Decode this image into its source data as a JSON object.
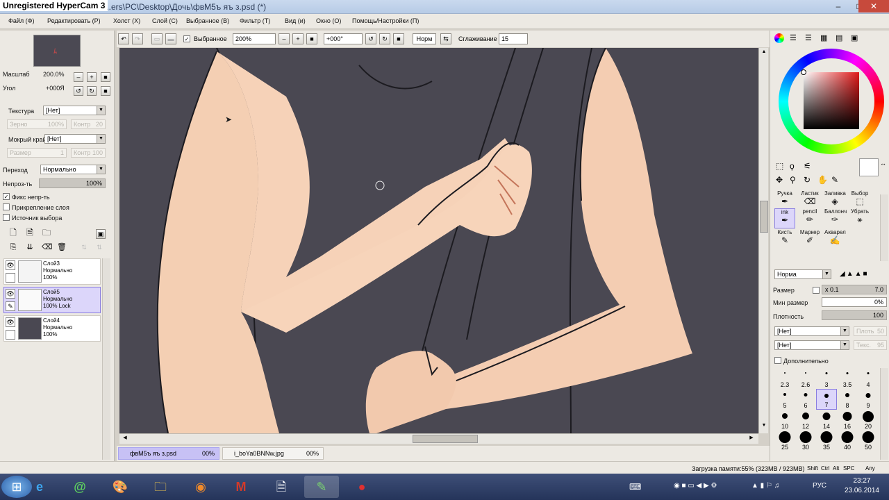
{
  "hypercam_label": "Unregistered HyperCam 3",
  "window": {
    "title": "...ers\\PC\\Desktop\\Дочь\\фвМ5ъ яъ з.psd (*)",
    "controls": [
      "–",
      "□",
      "✕"
    ]
  },
  "menu": [
    "Файл (Ф)",
    "Редактировать (Р)",
    "Холст (Х)",
    "Слой (С)",
    "Выбранное (В)",
    "Фильтр (Т)",
    "Вид (и)",
    "Окно (О)",
    "Помощь/Настройки (П)"
  ],
  "toolbar": {
    "selection_label": "Выбранное",
    "zoom_value": "200%",
    "angle_value": "+000°",
    "mode_label": "Норм",
    "smoothing_label": "Сглаживание",
    "smoothing_value": "15"
  },
  "left": {
    "scale_label": "Масштаб",
    "scale_value": "200.0%",
    "angle_label": "Угол",
    "angle_value": "+000Я",
    "texture_label": "Текстура",
    "texture_value": "[Нет]",
    "grain_label": "Зерно",
    "grain_value": "100%",
    "contrast_label": "Контр",
    "contrast_value": "20",
    "wet_label": "Мокрый край",
    "wet_value": "[Нет]",
    "size_label": "Размер",
    "size_value": "1",
    "contrast2_label": "Контр",
    "contrast2_value": "100",
    "blend_label": "Переход",
    "blend_value": "Нормально",
    "opacity_label": "Непроз-ть",
    "opacity_value": "100%",
    "cb_fix": "Фикс непр-ть",
    "cb_clip": "Прикрепление слоя",
    "cb_source": "Источник выбора",
    "layers": [
      {
        "name": "Слой3",
        "mode": "Нормально",
        "opacity": "100%"
      },
      {
        "name": "Слой5",
        "mode": "Нормально",
        "opacity": "100% Lock"
      },
      {
        "name": "Слой4",
        "mode": "Нормально",
        "opacity": "100%"
      }
    ]
  },
  "doc_tabs": [
    {
      "name": "фвМ5ъ яъ з.psd",
      "pct": "00%"
    },
    {
      "name": "i_boYa0BNNw.jpg",
      "pct": "00%"
    }
  ],
  "status": {
    "memory": "Загрузка памяти:55% (323MB / 923MB)",
    "keys": [
      "Shift",
      "Ctrl",
      "Alt",
      "SPC",
      "Any"
    ]
  },
  "right": {
    "tools": [
      {
        "label": "Ручка"
      },
      {
        "label": "Ластик"
      },
      {
        "label": "Заливка"
      },
      {
        "label": "Выбор"
      },
      {
        "label": "ink"
      },
      {
        "label": "pencil"
      },
      {
        "label": "Баллонч"
      },
      {
        "label": "Убрать"
      },
      {
        "label": "Кисть"
      },
      {
        "label": "Маркер"
      },
      {
        "label": "Акварел"
      }
    ],
    "brush_mode": "Норма",
    "size_label": "Размер",
    "size_mult": "x 0.1",
    "size_value": "7.0",
    "min_size_label": "Мин размер",
    "min_size_value": "0%",
    "density_label": "Плотность",
    "density_value": "100",
    "shape1_value": "[Нет]",
    "shape1_side": "Плоть",
    "shape1_num": "50",
    "shape2_value": "[Нет]",
    "shape2_side": "Текс.",
    "shape2_num": "95",
    "advanced_label": "Дополнительно",
    "brush_sizes": [
      "2.3",
      "2.6",
      "3",
      "3.5",
      "4",
      "5",
      "6",
      "7",
      "8",
      "9",
      "10",
      "12",
      "14",
      "16",
      "20",
      "25",
      "30",
      "35",
      "40",
      "50"
    ]
  },
  "taskbar": {
    "lang": "РУС",
    "time": "23:27",
    "date": "23.06.2014"
  }
}
